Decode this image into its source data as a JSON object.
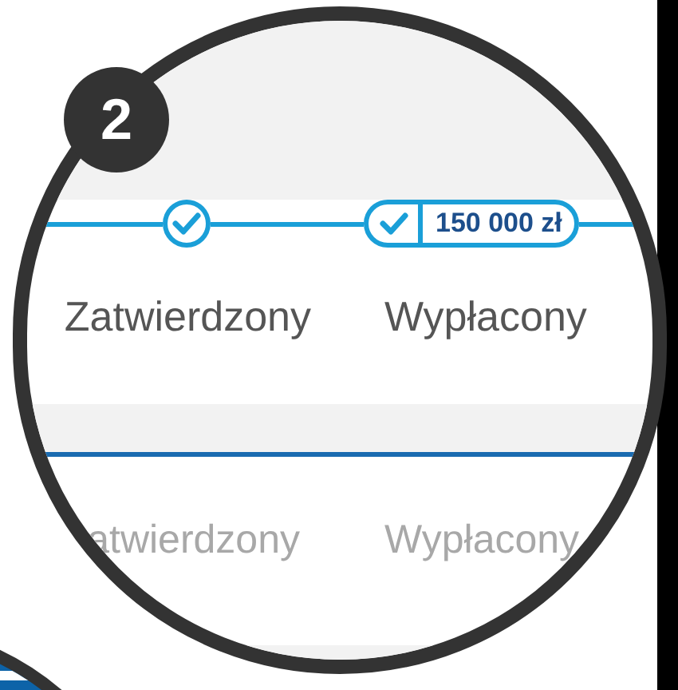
{
  "badge": "2",
  "steps": [
    {
      "label": "Zatwierdzony",
      "done": true
    },
    {
      "label": "Wypłacony",
      "done": true,
      "amount": "150 000 zł"
    }
  ],
  "lower_row": {
    "labels": [
      "atwierdzony",
      "Wypłacony"
    ]
  }
}
